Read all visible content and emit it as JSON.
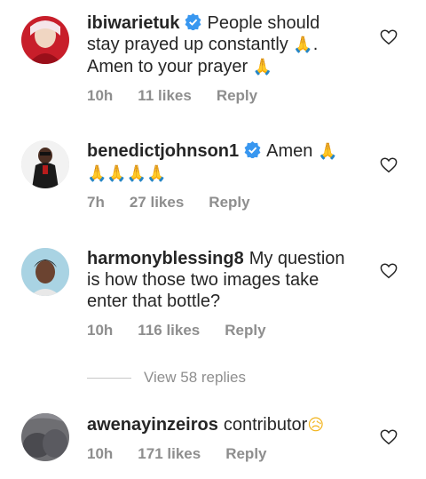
{
  "comments": [
    {
      "username": "ibiwarietuk",
      "verified": true,
      "text_a": "People should stay prayed up constantly ",
      "emoji_a": "🙏",
      "text_b": ". Amen to your prayer ",
      "emoji_b": "🙏",
      "time": "10h",
      "likes": "11 likes",
      "reply": "Reply"
    },
    {
      "username": "benedictjohnson1",
      "verified": true,
      "text_a": "Amen ",
      "emoji_a": "🙏🙏🙏🙏🙏",
      "time": "7h",
      "likes": "27 likes",
      "reply": "Reply"
    },
    {
      "username": "harmonyblessing8",
      "verified": false,
      "text_a": "My question is how those two images take enter that bottle?",
      "time": "10h",
      "likes": "116 likes",
      "reply": "Reply"
    },
    {
      "username": "awenayinzeiros",
      "verified": false,
      "text_a": "contributor",
      "emoji_a": "😥",
      "time": "10h",
      "likes": "171 likes",
      "reply": "Reply"
    }
  ],
  "view_replies": "View 58 replies",
  "icons": {
    "verified": "verified-badge-icon",
    "like": "heart-outline-icon"
  },
  "colors": {
    "verified": "#3897f0",
    "meta": "#8e8e8e",
    "text": "#262626"
  }
}
